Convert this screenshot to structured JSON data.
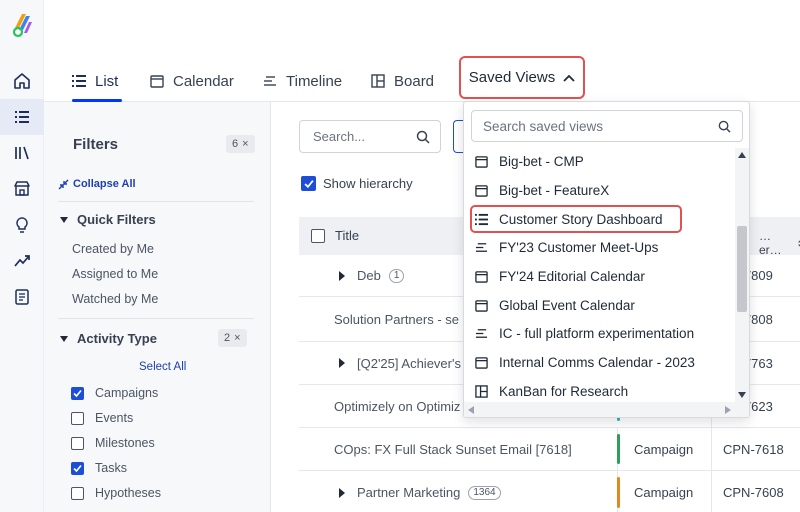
{
  "tabs": [
    {
      "label": "List",
      "icon": "list-icon",
      "active": true
    },
    {
      "label": "Calendar",
      "icon": "calendar-icon",
      "active": false
    },
    {
      "label": "Timeline",
      "icon": "timeline-icon",
      "active": false
    },
    {
      "label": "Board",
      "icon": "board-icon",
      "active": false
    }
  ],
  "saved_views": {
    "label": "Saved Views"
  },
  "filters": {
    "title": "Filters",
    "count": "6",
    "collapse_all": "Collapse All",
    "quick_filters": {
      "title": "Quick Filters",
      "items": [
        "Created by Me",
        "Assigned to Me",
        "Watched by Me"
      ]
    },
    "activity_type": {
      "title": "Activity Type",
      "count": "2",
      "select_all": "Select All",
      "items": [
        {
          "label": "Campaigns",
          "checked": true
        },
        {
          "label": "Events",
          "checked": false
        },
        {
          "label": "Milestones",
          "checked": false
        },
        {
          "label": "Tasks",
          "checked": true
        },
        {
          "label": "Hypotheses",
          "checked": false
        }
      ]
    },
    "clear_symbol": "×"
  },
  "main": {
    "search_placeholder": "Search...",
    "show_hierarchy": "Show hierarchy",
    "columns": {
      "title": "Title",
      "id_partial": "…er…"
    },
    "rows": [
      {
        "title": "Deb",
        "badge": "1",
        "expandable": true,
        "type": "",
        "id": "…I-7809"
      },
      {
        "title": "Solution Partners - se",
        "badge": "",
        "expandable": false,
        "type": "",
        "id": "…I-7808"
      },
      {
        "title": "[Q2'25] Achiever's",
        "badge": "",
        "expandable": true,
        "type": "",
        "id": "…I-7763"
      },
      {
        "title": "Optimizely on Optimiz",
        "badge": "",
        "expandable": false,
        "type": "",
        "id": "…I-7623"
      },
      {
        "title": "COps: FX Full Stack Sunset Email [7618]",
        "badge": "",
        "expandable": false,
        "type": "Campaign",
        "id": "CPN-7618",
        "type_color": "#2e9e5b"
      },
      {
        "title": "Partner Marketing",
        "badge": "1364",
        "expandable": true,
        "type": "Campaign",
        "id": "CPN-7608",
        "type_color": "#e08a1e"
      }
    ]
  },
  "saved_views_dropdown": {
    "search_placeholder": "Search saved views",
    "items": [
      {
        "label": "Big-bet - CMP",
        "icon": "calendar-icon"
      },
      {
        "label": "Big-bet - FeatureX",
        "icon": "calendar-icon"
      },
      {
        "label": "Customer Story Dashboard",
        "icon": "list-icon"
      },
      {
        "label": "FY'23 Customer Meet-Ups",
        "icon": "timeline-icon"
      },
      {
        "label": "FY'24 Editorial Calendar",
        "icon": "calendar-icon"
      },
      {
        "label": "Global Event Calendar",
        "icon": "calendar-icon"
      },
      {
        "label": "IC - full platform experimentation",
        "icon": "timeline-icon"
      },
      {
        "label": "Internal Comms Calendar - 2023",
        "icon": "calendar-icon"
      },
      {
        "label": "KanBan for Research",
        "icon": "board-icon"
      }
    ]
  },
  "colors": {
    "accent": "#0037ff",
    "highlight": "#e05252",
    "link": "#1e40af"
  }
}
